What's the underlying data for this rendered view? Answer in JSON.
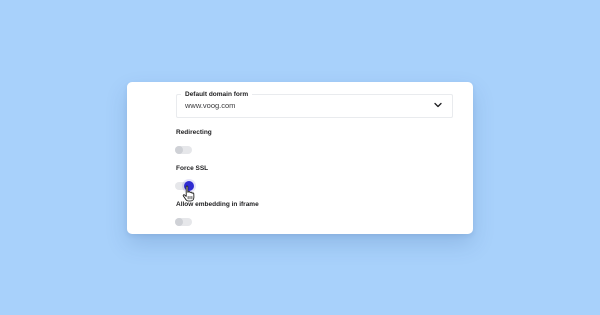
{
  "settings": {
    "domain": {
      "label": "Default domain form",
      "value": "www.voog.com",
      "icon": "chevron-down-icon"
    },
    "redirecting": {
      "label": "Redirecting",
      "enabled": false
    },
    "force_ssl": {
      "label": "Force SSL",
      "enabled": true
    },
    "iframe": {
      "label": "Allow embedding in iframe",
      "enabled": false
    }
  },
  "colors": {
    "background": "#a8d1fb",
    "card": "#ffffff",
    "toggle_on": "#2f2bd1",
    "toggle_off": "#cfd1d6",
    "text": "#1d1d1f"
  },
  "cursor": {
    "icon": "hand-pointer-icon"
  }
}
